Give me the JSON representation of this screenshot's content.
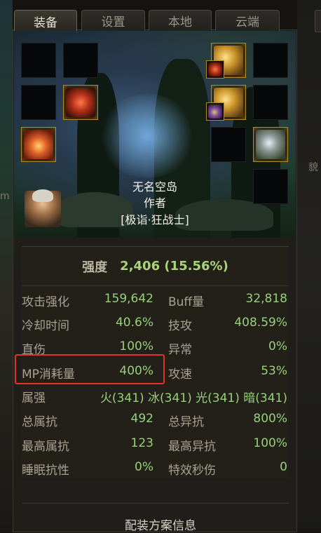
{
  "tabs": [
    {
      "label": "装备",
      "active": true
    },
    {
      "label": "设置",
      "active": false
    },
    {
      "label": "本地",
      "active": false
    },
    {
      "label": "云端",
      "active": false
    }
  ],
  "edge_text": {
    "right_fragment": "貌",
    "left_fragment": "m"
  },
  "character": {
    "name": "无名空岛",
    "subtitle": "作者",
    "class": "[极诣·狂战士]"
  },
  "equipment_slots": [
    {
      "position": "left-1-1",
      "icon": "empty-slot"
    },
    {
      "position": "left-1-2",
      "icon": "empty-slot"
    },
    {
      "position": "left-2-1",
      "icon": "empty-slot"
    },
    {
      "position": "left-2-2",
      "icon": "red-gauntlet-icon"
    },
    {
      "position": "left-3-1",
      "icon": "fire-armor-icon"
    },
    {
      "position": "right-1-1",
      "icon": "gold-weapon-icon"
    },
    {
      "position": "right-1-2",
      "icon": "empty-slot"
    },
    {
      "position": "right-2-1",
      "icon": "purple-gold-bracer-icon"
    },
    {
      "position": "right-2-2",
      "icon": "empty-slot"
    },
    {
      "position": "right-3-1",
      "icon": "empty-slot"
    },
    {
      "position": "right-3-2",
      "icon": "steel-ring-icon"
    },
    {
      "position": "right-4-1",
      "icon": "empty-slot"
    }
  ],
  "strength": {
    "label": "强度",
    "value": "2,406 (15.56%)"
  },
  "stats": [
    {
      "left_label": "攻击强化",
      "left_value": "159,642",
      "right_label": "Buff量",
      "right_value": "32,818"
    },
    {
      "left_label": "冷却时间",
      "left_value": "40.6%",
      "right_label": "技攻",
      "right_value": "408.59%"
    },
    {
      "left_label": "直伤",
      "left_value": "100%",
      "right_label": "异常",
      "right_value": "0%"
    },
    {
      "left_label": "MP消耗量",
      "left_value": "400%",
      "right_label": "攻速",
      "right_value": "53%"
    },
    {
      "left_label": "属强",
      "left_value": "火(341) 冰(341) 光(341) 暗(341)",
      "right_label": "",
      "right_value": ""
    },
    {
      "left_label": "总属抗",
      "left_value": "492",
      "right_label": "总异抗",
      "right_value": "800%"
    },
    {
      "left_label": "最高属抗",
      "left_value": "123",
      "right_label": "最高异抗",
      "right_value": "100%"
    },
    {
      "left_label": "睡眠抗性",
      "left_value": "0%",
      "right_label": "特效秒伤",
      "right_value": "0"
    }
  ],
  "footer": {
    "title": "配装方案信息"
  },
  "colors": {
    "value_green": "#98d07a",
    "label_beige": "#a8a291",
    "highlight_red": "#e0312a",
    "slot_gold": "#b08a2a"
  }
}
